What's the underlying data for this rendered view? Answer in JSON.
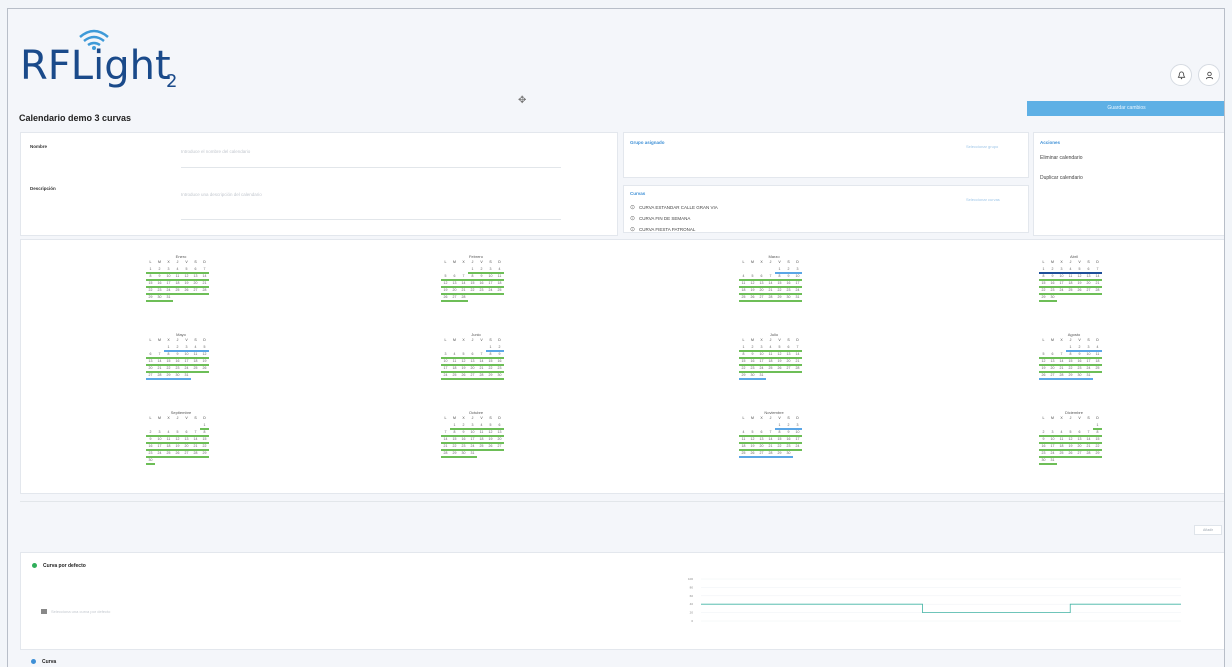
{
  "brand": {
    "name": "RFLight",
    "suffix": "2"
  },
  "header": {
    "notifications_icon": "bell-icon",
    "user_icon": "user-icon"
  },
  "page": {
    "title": "Calendario demo 3 curvas",
    "save_label": "Guardar cambios"
  },
  "form": {
    "name_label": "Nombre",
    "name_placeholder": "Introduce el nombre del calendario",
    "description_label": "Descripción",
    "description_placeholder": "Introduce una descripción del calendario"
  },
  "group": {
    "label": "Grupo asignado",
    "button": "Seleccionar grupo"
  },
  "curves": {
    "label": "Curvas",
    "button": "Seleccionar curvas",
    "items": [
      "CURVA ESTANDAR CALLE GRAN VIA",
      "CURVA FIN DE SEMANA",
      "CURVA FIESTA PATRONAL"
    ]
  },
  "actions": {
    "label": "Acciones",
    "items": [
      "Eliminar calendario",
      "Duplicar calendario"
    ]
  },
  "week_headers": [
    "L",
    "M",
    "X",
    "J",
    "V",
    "S",
    "D"
  ],
  "months": [
    {
      "name": "Enero",
      "offset": 0,
      "days": 31,
      "rows": [
        "g",
        "g",
        "g",
        "g",
        "g",
        "g"
      ]
    },
    {
      "name": "Febrero",
      "offset": 3,
      "days": 28,
      "rows": [
        "g",
        "g",
        "g",
        "g",
        "g"
      ]
    },
    {
      "name": "Marzo",
      "offset": 4,
      "days": 31,
      "rows": [
        "b",
        "g",
        "g",
        "g",
        "g"
      ]
    },
    {
      "name": "Abril",
      "offset": 0,
      "days": 30,
      "rows": [
        "d",
        "g",
        "g",
        "g",
        "g"
      ]
    },
    {
      "name": "Mayo",
      "offset": 2,
      "days": 31,
      "rows": [
        "b",
        "g",
        "g",
        "g",
        "b"
      ]
    },
    {
      "name": "Junio",
      "offset": 5,
      "days": 30,
      "rows": [
        "b",
        "g",
        "g",
        "g",
        "g"
      ]
    },
    {
      "name": "Julio",
      "offset": 0,
      "days": 31,
      "rows": [
        "g",
        "g",
        "g",
        "g",
        "b"
      ]
    },
    {
      "name": "Agosto",
      "offset": 3,
      "days": 31,
      "rows": [
        "b",
        "g",
        "g",
        "g",
        "b"
      ]
    },
    {
      "name": "Septiembre",
      "offset": 6,
      "days": 30,
      "rows": [
        "g",
        "g",
        "g",
        "g",
        "g",
        "g"
      ]
    },
    {
      "name": "Octubre",
      "offset": 1,
      "days": 31,
      "rows": [
        "g",
        "g",
        "g",
        "g",
        "g"
      ]
    },
    {
      "name": "Noviembre",
      "offset": 4,
      "days": 30,
      "rows": [
        "b",
        "g",
        "g",
        "g",
        "b"
      ]
    },
    {
      "name": "Diciembre",
      "offset": 6,
      "days": 31,
      "rows": [
        "g",
        "g",
        "g",
        "g",
        "g",
        "g"
      ]
    }
  ],
  "toolbar": {
    "button": "Añadir"
  },
  "default_curve": {
    "title": "Curva por defecto",
    "placeholder": "Selecciona una curva por defecto",
    "dot_color": "#2fae5a"
  },
  "curve_section": {
    "title": "Curva",
    "dot_color": "#3d8fd6"
  },
  "colors": {
    "accent": "#5eb0e5",
    "green": "#6dbe57",
    "blue": "#5ba6e6",
    "dark_blue": "#1f4f9a",
    "line": "#41b3a3"
  },
  "chart_data": {
    "type": "line",
    "y_ticks": [
      "100",
      "80",
      "60",
      "40",
      "20",
      "0"
    ],
    "ylim": [
      0,
      100
    ],
    "series": [
      {
        "values": [
          40,
          40,
          40,
          40,
          40,
          40,
          20,
          20,
          20,
          20,
          40,
          40,
          40,
          40
        ]
      }
    ]
  }
}
